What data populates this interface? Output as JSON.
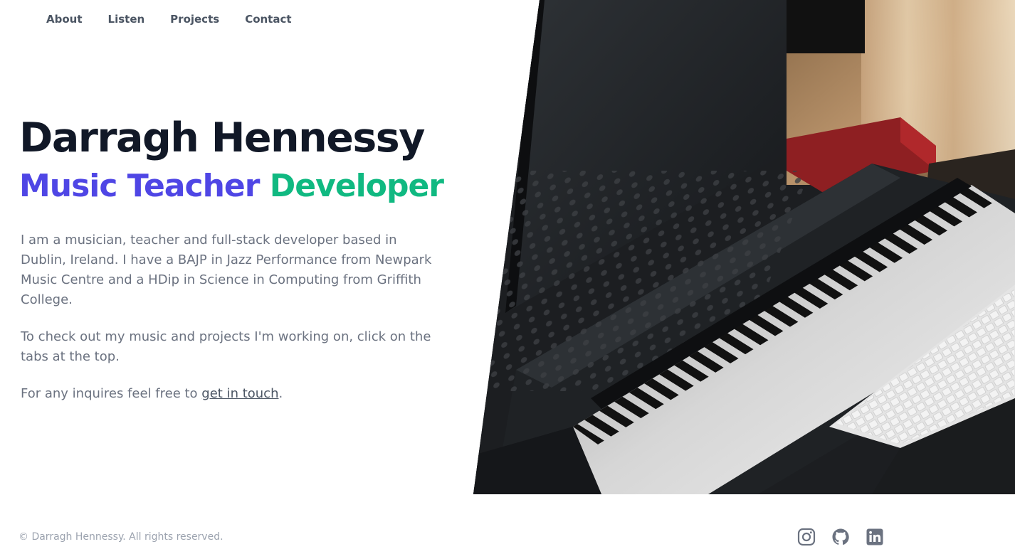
{
  "nav": {
    "items": [
      {
        "label": "About"
      },
      {
        "label": "Listen"
      },
      {
        "label": "Projects"
      },
      {
        "label": "Contact"
      }
    ]
  },
  "hero": {
    "name": "Darragh Hennessy",
    "role1": "Music Teacher",
    "role2": "Developer",
    "paragraph1": "I am a musician, teacher and full-stack developer based in Dublin, Ireland. I have a BAJP in Jazz Performance from Newpark Music Centre and a HDip in Science in Computing from Griffith College.",
    "paragraph2": "To check out my music and projects I'm working on, click on the tabs at the top.",
    "paragraph3_prefix": "For any inquires feel free to ",
    "paragraph3_link": "get in touch",
    "paragraph3_suffix": "."
  },
  "footer": {
    "copyright": "© Darragh Hennessy. All rights reserved.",
    "social": [
      {
        "icon": "instagram-icon"
      },
      {
        "icon": "github-icon"
      },
      {
        "icon": "linkedin-icon"
      }
    ]
  },
  "colors": {
    "heading": "#111827",
    "role1": "#4f46e5",
    "role2": "#10b981",
    "body_text": "#6b7280",
    "footer_text": "#9ca3af"
  }
}
